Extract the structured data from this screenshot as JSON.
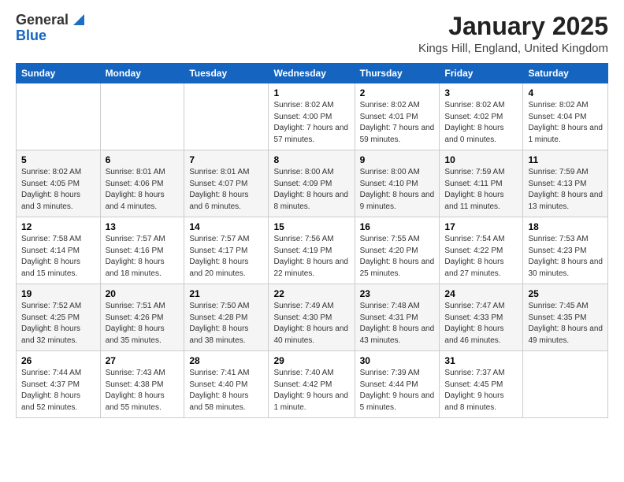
{
  "logo": {
    "general": "General",
    "blue": "Blue"
  },
  "title": {
    "month": "January 2025",
    "location": "Kings Hill, England, United Kingdom"
  },
  "weekdays": [
    "Sunday",
    "Monday",
    "Tuesday",
    "Wednesday",
    "Thursday",
    "Friday",
    "Saturday"
  ],
  "weeks": [
    [
      {
        "day": "",
        "info": ""
      },
      {
        "day": "",
        "info": ""
      },
      {
        "day": "",
        "info": ""
      },
      {
        "day": "1",
        "info": "Sunrise: 8:02 AM\nSunset: 4:00 PM\nDaylight: 7 hours and 57 minutes."
      },
      {
        "day": "2",
        "info": "Sunrise: 8:02 AM\nSunset: 4:01 PM\nDaylight: 7 hours and 59 minutes."
      },
      {
        "day": "3",
        "info": "Sunrise: 8:02 AM\nSunset: 4:02 PM\nDaylight: 8 hours and 0 minutes."
      },
      {
        "day": "4",
        "info": "Sunrise: 8:02 AM\nSunset: 4:04 PM\nDaylight: 8 hours and 1 minute."
      }
    ],
    [
      {
        "day": "5",
        "info": "Sunrise: 8:02 AM\nSunset: 4:05 PM\nDaylight: 8 hours and 3 minutes."
      },
      {
        "day": "6",
        "info": "Sunrise: 8:01 AM\nSunset: 4:06 PM\nDaylight: 8 hours and 4 minutes."
      },
      {
        "day": "7",
        "info": "Sunrise: 8:01 AM\nSunset: 4:07 PM\nDaylight: 8 hours and 6 minutes."
      },
      {
        "day": "8",
        "info": "Sunrise: 8:00 AM\nSunset: 4:09 PM\nDaylight: 8 hours and 8 minutes."
      },
      {
        "day": "9",
        "info": "Sunrise: 8:00 AM\nSunset: 4:10 PM\nDaylight: 8 hours and 9 minutes."
      },
      {
        "day": "10",
        "info": "Sunrise: 7:59 AM\nSunset: 4:11 PM\nDaylight: 8 hours and 11 minutes."
      },
      {
        "day": "11",
        "info": "Sunrise: 7:59 AM\nSunset: 4:13 PM\nDaylight: 8 hours and 13 minutes."
      }
    ],
    [
      {
        "day": "12",
        "info": "Sunrise: 7:58 AM\nSunset: 4:14 PM\nDaylight: 8 hours and 15 minutes."
      },
      {
        "day": "13",
        "info": "Sunrise: 7:57 AM\nSunset: 4:16 PM\nDaylight: 8 hours and 18 minutes."
      },
      {
        "day": "14",
        "info": "Sunrise: 7:57 AM\nSunset: 4:17 PM\nDaylight: 8 hours and 20 minutes."
      },
      {
        "day": "15",
        "info": "Sunrise: 7:56 AM\nSunset: 4:19 PM\nDaylight: 8 hours and 22 minutes."
      },
      {
        "day": "16",
        "info": "Sunrise: 7:55 AM\nSunset: 4:20 PM\nDaylight: 8 hours and 25 minutes."
      },
      {
        "day": "17",
        "info": "Sunrise: 7:54 AM\nSunset: 4:22 PM\nDaylight: 8 hours and 27 minutes."
      },
      {
        "day": "18",
        "info": "Sunrise: 7:53 AM\nSunset: 4:23 PM\nDaylight: 8 hours and 30 minutes."
      }
    ],
    [
      {
        "day": "19",
        "info": "Sunrise: 7:52 AM\nSunset: 4:25 PM\nDaylight: 8 hours and 32 minutes."
      },
      {
        "day": "20",
        "info": "Sunrise: 7:51 AM\nSunset: 4:26 PM\nDaylight: 8 hours and 35 minutes."
      },
      {
        "day": "21",
        "info": "Sunrise: 7:50 AM\nSunset: 4:28 PM\nDaylight: 8 hours and 38 minutes."
      },
      {
        "day": "22",
        "info": "Sunrise: 7:49 AM\nSunset: 4:30 PM\nDaylight: 8 hours and 40 minutes."
      },
      {
        "day": "23",
        "info": "Sunrise: 7:48 AM\nSunset: 4:31 PM\nDaylight: 8 hours and 43 minutes."
      },
      {
        "day": "24",
        "info": "Sunrise: 7:47 AM\nSunset: 4:33 PM\nDaylight: 8 hours and 46 minutes."
      },
      {
        "day": "25",
        "info": "Sunrise: 7:45 AM\nSunset: 4:35 PM\nDaylight: 8 hours and 49 minutes."
      }
    ],
    [
      {
        "day": "26",
        "info": "Sunrise: 7:44 AM\nSunset: 4:37 PM\nDaylight: 8 hours and 52 minutes."
      },
      {
        "day": "27",
        "info": "Sunrise: 7:43 AM\nSunset: 4:38 PM\nDaylight: 8 hours and 55 minutes."
      },
      {
        "day": "28",
        "info": "Sunrise: 7:41 AM\nSunset: 4:40 PM\nDaylight: 8 hours and 58 minutes."
      },
      {
        "day": "29",
        "info": "Sunrise: 7:40 AM\nSunset: 4:42 PM\nDaylight: 9 hours and 1 minute."
      },
      {
        "day": "30",
        "info": "Sunrise: 7:39 AM\nSunset: 4:44 PM\nDaylight: 9 hours and 5 minutes."
      },
      {
        "day": "31",
        "info": "Sunrise: 7:37 AM\nSunset: 4:45 PM\nDaylight: 9 hours and 8 minutes."
      },
      {
        "day": "",
        "info": ""
      }
    ]
  ]
}
